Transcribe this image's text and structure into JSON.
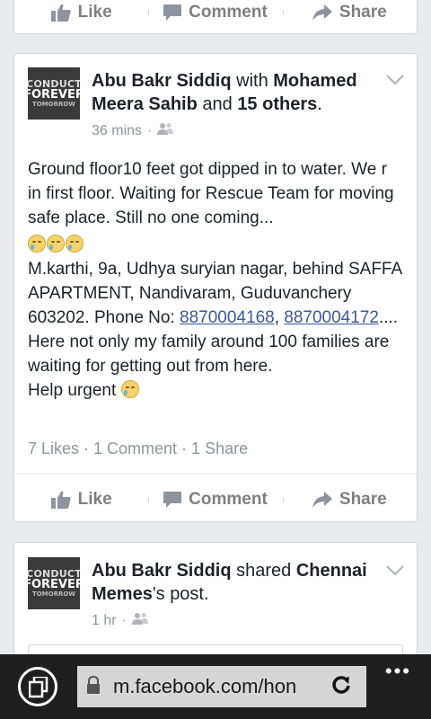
{
  "actions": {
    "like": "Like",
    "comment": "Comment",
    "share": "Share"
  },
  "logo": {
    "line1": "CONDUCT",
    "line2": "FOREVER",
    "line3": "TOMORROW"
  },
  "post1": {
    "author": "Abu Bakr Siddiq",
    "with_word": " with ",
    "tagged": "Mohamed Meera Sahib",
    "and_word": " and ",
    "others": "15 others",
    "end": ".",
    "time": "36 mins",
    "dot": "·",
    "audience_icon": "friends-icon",
    "text_1": "Ground floor10 feet got dipped in to water. We r in first floor. Waiting for Rescue Team for moving safe place. Still no one coming...",
    "text_2": "M.karthi, 9a, Udhya suryian nagar, behind SAFFA APARTMENT, Nandivaram, Guduvanchery 603202. Phone No:",
    "phone1": "8870004168",
    "comma": ", ",
    "phone2": "8870004172",
    "text_3": ".... Here not only my family around 100 families are waiting for getting out from here.",
    "text_4": "Help urgent",
    "stats": "7 Likes · 1 Comment · 1 Share"
  },
  "post2": {
    "author": "Abu Bakr Siddiq",
    "shared_word": " shared ",
    "page": "Chennai Memes",
    "possessive": "'s post.",
    "time": "1 hr",
    "dot": "·"
  },
  "browser": {
    "url": "m.facebook.com/hon",
    "more": "•••"
  },
  "colors": {
    "link": "#3b5998",
    "background": "#e9ebee",
    "bar": "#1f1f1f"
  }
}
